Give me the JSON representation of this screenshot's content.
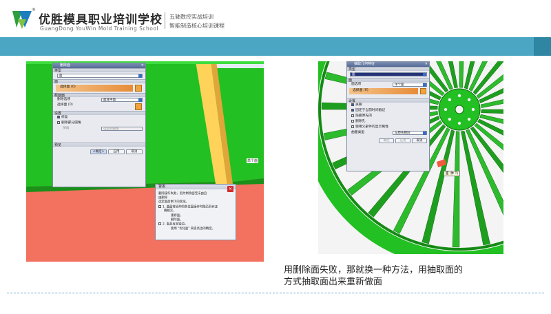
{
  "header": {
    "brand_title": "优胜模具职业培训学校",
    "brand_subtitle": "GuangDong YouWin Mold Training School",
    "registered_mark": "®",
    "slogan_line1": "五轴数控实战培训",
    "slogan_line2": "智能制造核心培训课程"
  },
  "left_screenshot": {
    "dialog_title": "删除面",
    "type_section": "类型",
    "type_value": "面",
    "face_section": "面",
    "face_select_label": "选择面 (0)",
    "cut_section": "截面面",
    "cut_option_label": "删除选项",
    "cut_option_value": "面或平面",
    "cut_select_label": "选择面 (0)",
    "settings_section": "设置",
    "settings_cb1": "修复",
    "settings_cb2": "删除部分圆角",
    "settings_field_label": "倒角",
    "settings_field_value": "选定的圆角",
    "preview_section": "预览",
    "ok_button": "<确定>",
    "apply_button": "应用",
    "cancel_button": "取消",
    "single_face_tag": "单个面",
    "alert": {
      "title": "警报",
      "line1": "删除操作失败，因为剩余面无法由自",
      "line2": "由删除",
      "line3": "选定面后剩下的区域。",
      "line4": "1. 曲面将延伸的各位面操作时能否具有正",
      "line5": "确相交。",
      "line6": "重修面。",
      "line7": "删除面。",
      "line8": "2. 面具有容错边。",
      "line9": "使用 \"优化面\" 来提高边的精度。"
    }
  },
  "right_screenshot": {
    "dialog_title": "抽取几何特征",
    "type_section": "类型",
    "type_value": "面",
    "face_section": "面",
    "face_option_label": "面选项",
    "face_option_value": "单个面",
    "face_select_label": "选择面 (0)",
    "settings_section": "设置",
    "cb1": "关联",
    "cb2": "固定于当前时间戳记",
    "cb3": "隐藏原先的",
    "cb4": "删除孔",
    "cb5": "使用父部件的显示属性",
    "surface_type_label": "曲面类型",
    "surface_type_value": "与原先相同",
    "ok_button": "确定",
    "apply_button": "应用",
    "cancel_button": "取消",
    "tooltip": "面 (体 T)"
  },
  "caption": {
    "line1": "用删除面失败，那就换一种方法，用抽取面的",
    "line2": "方式抽取面出来重新做面"
  },
  "colors": {
    "teal_bar": "#4aa6c2",
    "left_bg": "#f2715f",
    "green_model": "#22c022",
    "right_bg": "#f4f4f4"
  }
}
